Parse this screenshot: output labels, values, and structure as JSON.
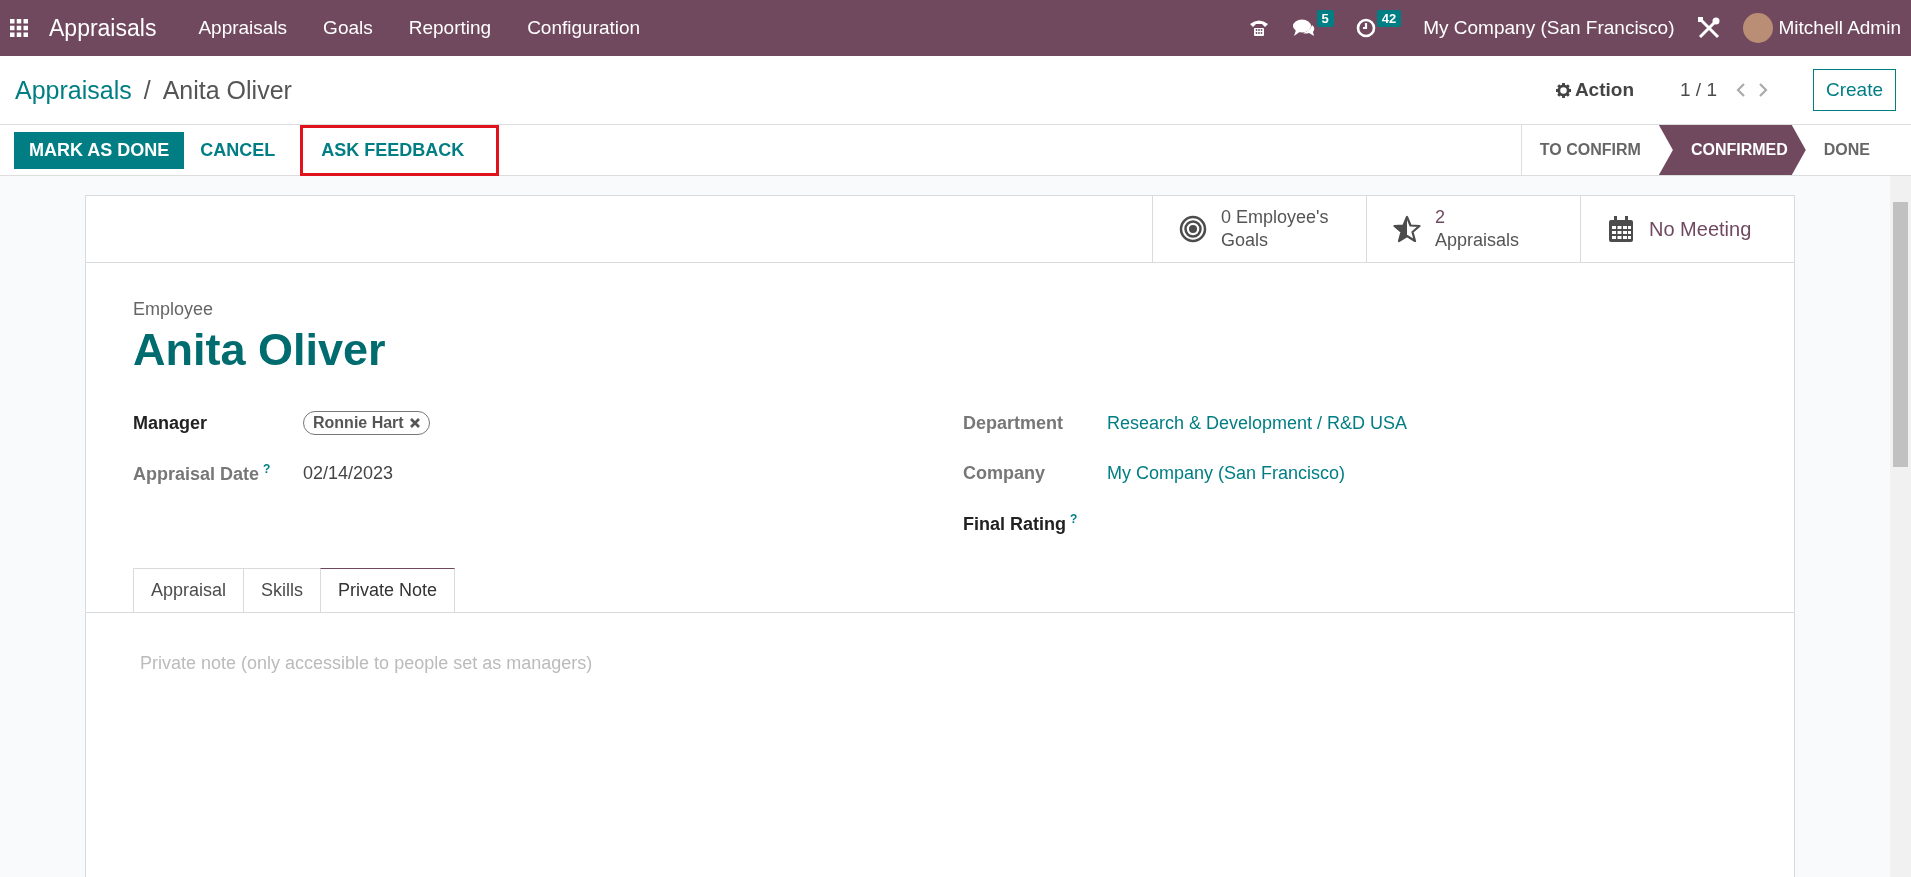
{
  "navbar": {
    "app_name": "Appraisals",
    "menu": [
      "Appraisals",
      "Goals",
      "Reporting",
      "Configuration"
    ],
    "messages_count": "5",
    "activities_count": "42",
    "company": "My Company (San Francisco)",
    "user": "Mitchell Admin"
  },
  "control_panel": {
    "breadcrumb": [
      "Appraisals",
      "Anita Oliver"
    ],
    "breadcrumb_separator": "/",
    "action": "Action",
    "pager": "1 / 1",
    "create": "Create"
  },
  "buttons": [
    {
      "label": "MARK AS DONE",
      "kind": "primary",
      "highlighted": false
    },
    {
      "label": "CANCEL",
      "kind": "secondary",
      "highlighted": false
    },
    {
      "label": "ASK FEEDBACK",
      "kind": "secondary",
      "highlighted": true
    }
  ],
  "stages": [
    {
      "label": "TO CONFIRM",
      "selected": false
    },
    {
      "label": "CONFIRMED",
      "selected": true
    },
    {
      "label": "DONE",
      "selected": false
    }
  ],
  "smart_buttons": [
    {
      "kind": "target",
      "value": "0 Employee's",
      "label": "Goals"
    },
    {
      "kind": "star",
      "value": "2",
      "label": "Appraisals"
    },
    {
      "kind": "calendar",
      "value": "No Meeting"
    }
  ],
  "employee_label": "Employee",
  "employee_name": "Anita Oliver",
  "left_fields": [
    {
      "label": "Manager",
      "required": true,
      "kind": "tag",
      "value": "Ronnie Hart"
    },
    {
      "label": "Appraisal Date",
      "required": false,
      "help": "?",
      "kind": "text",
      "value": "02/14/2023"
    }
  ],
  "right_fields": [
    {
      "label": "Department",
      "required": false,
      "kind": "link",
      "value": "Research & Development / R&D USA"
    },
    {
      "label": "Company",
      "required": false,
      "kind": "link",
      "value": "My Company (San Francisco)"
    },
    {
      "label": "Final Rating",
      "required": true,
      "help": "?",
      "kind": "empty"
    }
  ],
  "tabs": [
    {
      "label": "Appraisal",
      "selected": false
    },
    {
      "label": "Skills",
      "selected": false
    },
    {
      "label": "Private Note",
      "selected": true
    }
  ],
  "note": {
    "placeholder": "Private note (only accessible to people set as managers)"
  }
}
